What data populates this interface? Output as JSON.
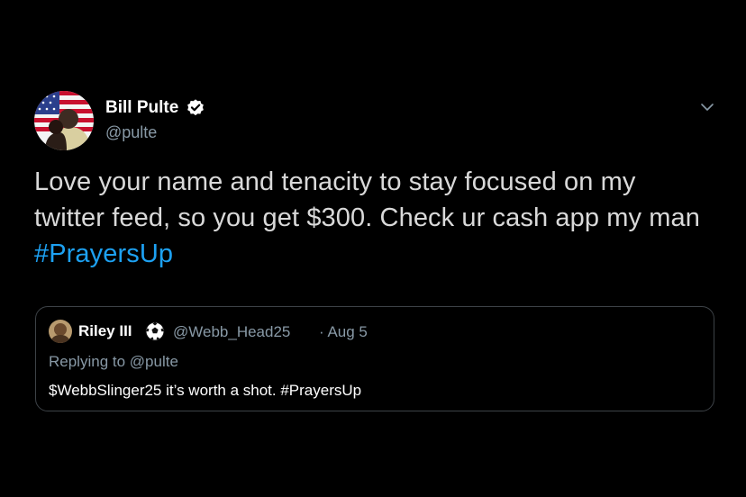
{
  "author": {
    "name": "Bill Pulte",
    "handle": "@pulte",
    "verified": true
  },
  "tweet": {
    "text": "Love your name and tenacity to stay focused on my twitter feed, so you get $300. Check ur cash app my man ",
    "hashtag": "#PrayersUp"
  },
  "quoted_tweet": {
    "name": "Riley III",
    "handle": "@Webb_Head25",
    "date": "· Aug 5",
    "replying_to": "Replying to @pulte",
    "text": "$WebbSlinger25 it’s worth a shot. #PrayersUp"
  },
  "colors": {
    "background": "#000000",
    "text": "#d9d9d9",
    "secondary_text": "#8899a6",
    "hashtag": "#1da1f2",
    "card_border": "#3d4247"
  },
  "icons": {
    "verified": "verified-badge-icon",
    "menu": "chevron-down-icon",
    "emoji": "soccer-ball-icon"
  }
}
